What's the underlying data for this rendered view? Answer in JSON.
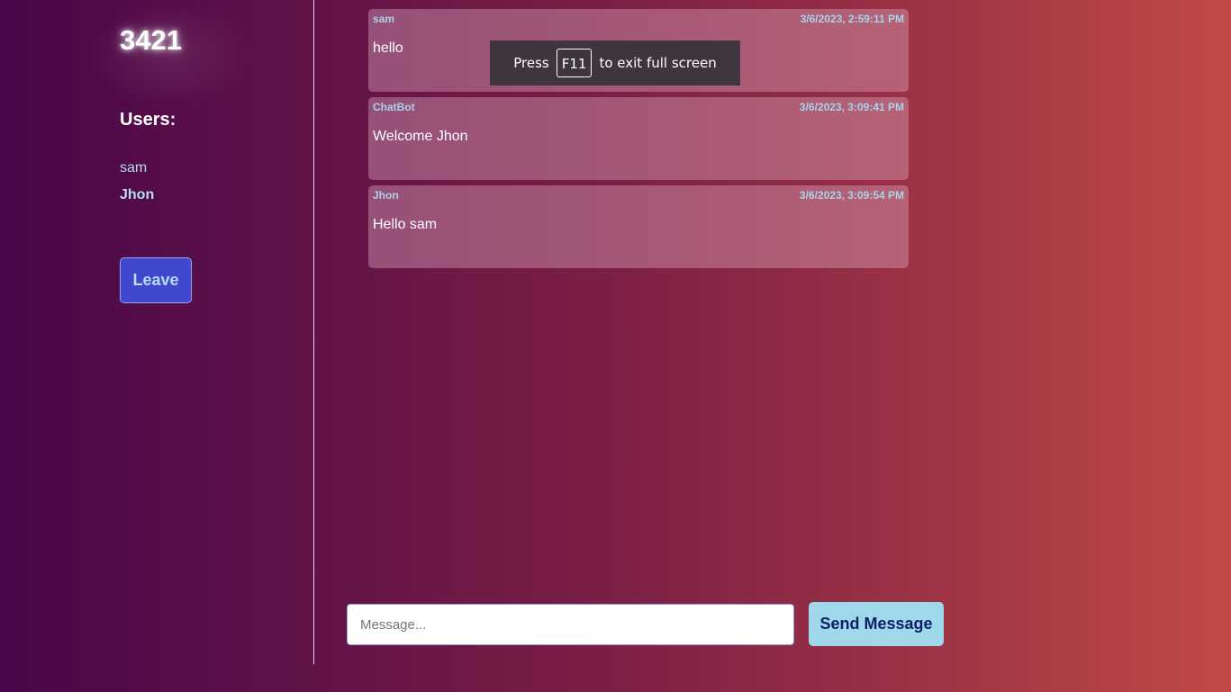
{
  "sidebar": {
    "room_name": "3421",
    "users_heading": "Users:",
    "users": [
      {
        "name": "sam",
        "current": false
      },
      {
        "name": "Jhon",
        "current": true
      }
    ],
    "leave_label": "Leave"
  },
  "messages": [
    {
      "user": "sam",
      "time": "3/6/2023, 2:59:11 PM",
      "text": "hello"
    },
    {
      "user": "ChatBot",
      "time": "3/6/2023, 3:09:41 PM",
      "text": "Welcome Jhon"
    },
    {
      "user": "Jhon",
      "time": "3/6/2023, 3:09:54 PM",
      "text": "Hello sam"
    }
  ],
  "fullscreen_notice": {
    "prefix": "Press",
    "key": "F11",
    "suffix": "to exit full screen"
  },
  "compose": {
    "placeholder": "Message...",
    "value": "",
    "send_label": "Send Message"
  },
  "colors": {
    "accent_text": "#b6dcef",
    "leave_button": "#4148cf",
    "send_button": "#9fd8ea",
    "send_button_text": "#0e1f66"
  }
}
